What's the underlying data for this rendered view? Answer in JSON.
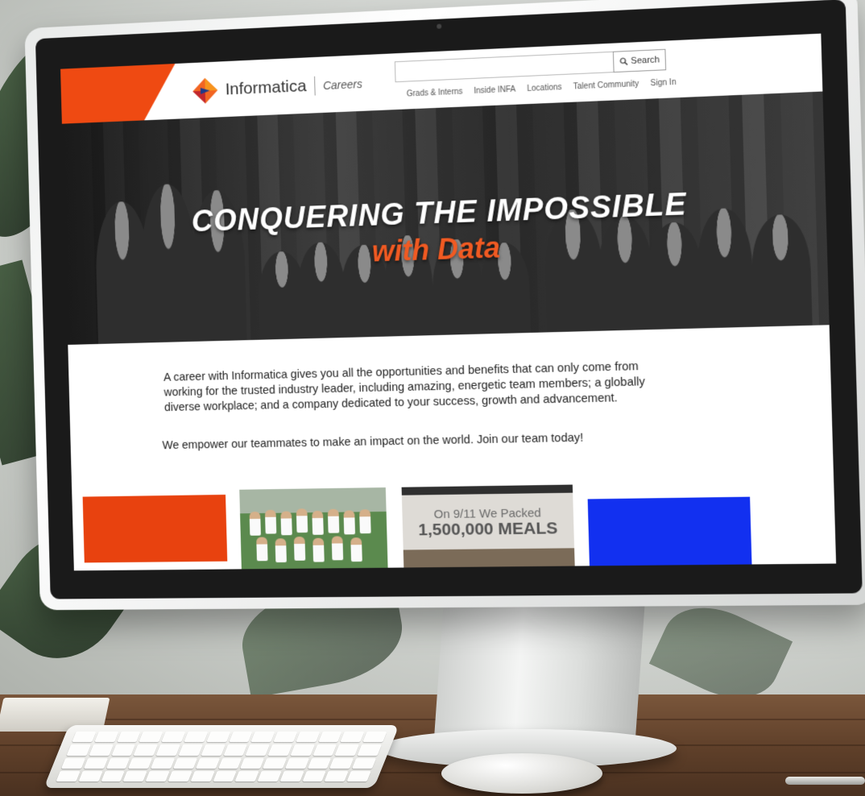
{
  "brand": {
    "name": "Informatica",
    "section": "Careers",
    "accent_color": "#ef4a12",
    "icon": "informatica-diamond-logo"
  },
  "search": {
    "placeholder": "",
    "button_label": "Search",
    "icon": "search-icon"
  },
  "nav": {
    "items": [
      {
        "label": "Grads & Interns"
      },
      {
        "label": "Inside INFA"
      },
      {
        "label": "Locations"
      },
      {
        "label": "Talent Community"
      },
      {
        "label": "Sign In"
      }
    ]
  },
  "hero": {
    "title": "CONQUERING THE IMPOSSIBLE",
    "subtitle": "with Data",
    "subtitle_color": "#f15a22"
  },
  "main": {
    "intro": "A career with Informatica gives you all the opportunities and benefits that can only come from working for the trusted industry leader, including amazing, energetic team members; a globally diverse workplace; and a company dedicated to your success, growth and advancement.",
    "tagline": "We empower our teammates to make an impact on the world.  Join our team today!"
  },
  "tiles": {
    "tile1_color": "#e8420f",
    "tile4_color": "#1230f0",
    "meals_line1": "On 9/11 We Packed",
    "meals_line2": "1,500,000 MEALS"
  }
}
